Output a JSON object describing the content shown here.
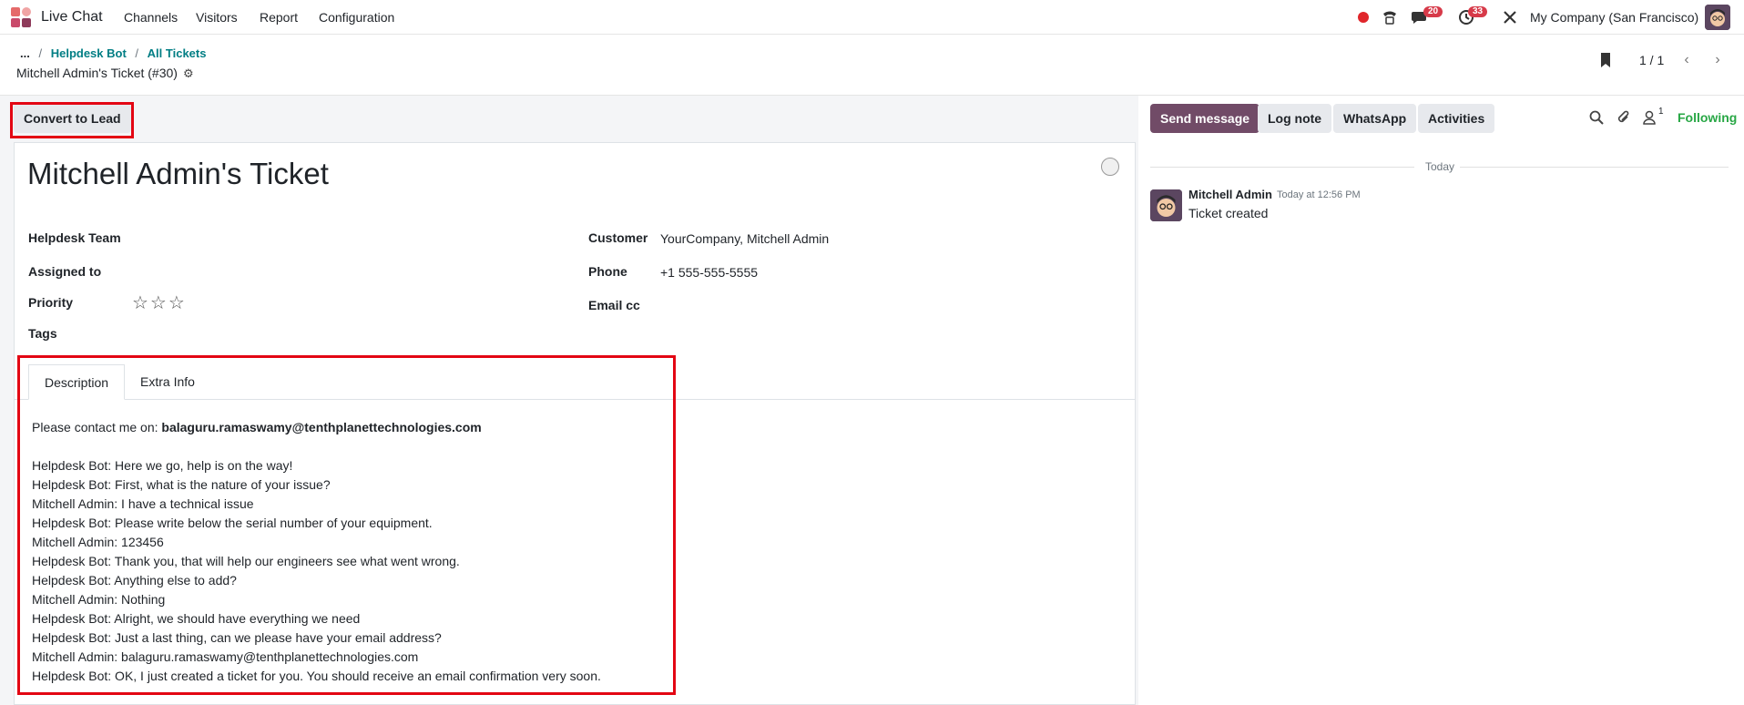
{
  "nav": {
    "app_name": "Live Chat",
    "menus": [
      "Channels",
      "Visitors",
      "Report",
      "Configuration"
    ],
    "chat_badge": "20",
    "activity_badge": "33",
    "company": "My Company (San Francisco)"
  },
  "breadcrumb": {
    "ellipsis": "...",
    "items": [
      "Helpdesk Bot",
      "All Tickets"
    ],
    "current": "Mitchell Admin's Ticket (#30)"
  },
  "pager": {
    "value": "1 / 1"
  },
  "actions": {
    "convert_to_lead": "Convert to Lead"
  },
  "form": {
    "title": "Mitchell Admin's Ticket",
    "left_fields": [
      {
        "label": "Helpdesk Team",
        "value": ""
      },
      {
        "label": "Assigned to",
        "value": ""
      },
      {
        "label": "Priority",
        "value": ""
      },
      {
        "label": "Tags",
        "value": ""
      }
    ],
    "priority_stars": "☆☆☆",
    "right_fields": [
      {
        "label": "Customer",
        "value": "YourCompany, Mitchell Admin"
      },
      {
        "label": "Phone",
        "value": "+1 555-555-5555"
      },
      {
        "label": "Email cc",
        "value": ""
      }
    ],
    "tabs": [
      "Description",
      "Extra Info"
    ],
    "description": {
      "contact_prefix": "Please contact me on: ",
      "contact_email": "balaguru.ramaswamy@tenthplanettechnologies.com",
      "lines": [
        "Helpdesk Bot: Here we go, help is on the way!",
        "Helpdesk Bot: First, what is the nature of your issue?",
        "Mitchell Admin: I have a technical issue",
        "Helpdesk Bot: Please write below the serial number of your equipment.",
        "Mitchell Admin: 123456",
        "Helpdesk Bot: Thank you, that will help our engineers see what went wrong.",
        "Helpdesk Bot: Anything else to add?",
        "Mitchell Admin: Nothing",
        "Helpdesk Bot: Alright, we should have everything we need",
        "Helpdesk Bot: Just a last thing, can we please have your email address?",
        "Mitchell Admin: balaguru.ramaswamy@tenthplanettechnologies.com",
        "Helpdesk Bot: OK, I just created a ticket for you. You should receive an email confirmation very soon."
      ]
    }
  },
  "chatter": {
    "buttons": [
      "Send message",
      "Log note",
      "WhatsApp",
      "Activities"
    ],
    "follower_count": "1",
    "following": "Following",
    "date_separator": "Today",
    "message": {
      "author": "Mitchell Admin",
      "time": "Today at 12:56 PM",
      "body": "Ticket created"
    }
  }
}
